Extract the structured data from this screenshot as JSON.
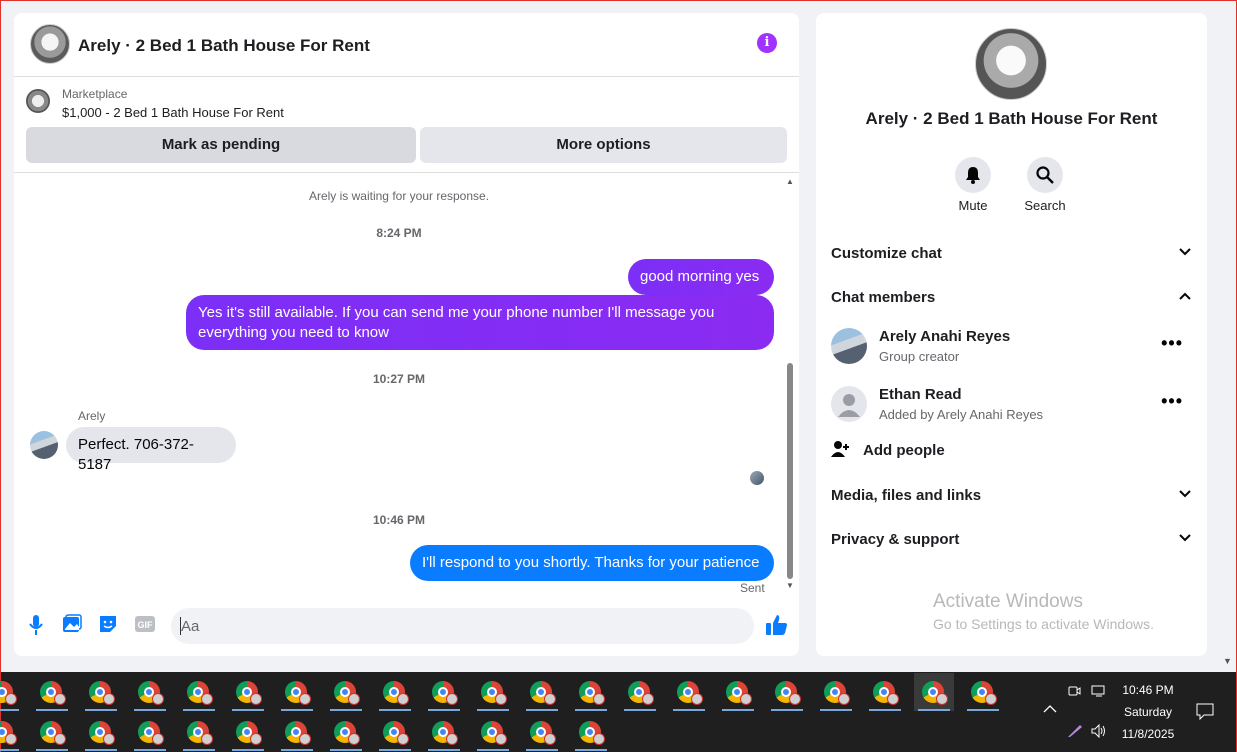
{
  "chat": {
    "header_title": "Arely · 2 Bed 1 Bath House For Rent",
    "marketplace_label": "Marketplace",
    "listing": "$1,000 - 2 Bed 1 Bath House For Rent",
    "mark_pending": "Mark as pending",
    "more_options": "More options",
    "waiting": "Arely is waiting for your response.",
    "time1": "8:24 PM",
    "msg1": "good morning yes",
    "msg2": "Yes it's still available. If you can send me your phone number I'll message you everything you need to know",
    "time2": "10:27 PM",
    "sender": "Arely",
    "msg3": "Perfect. 706-372-5187",
    "time3": "10:46 PM",
    "msg4": "I'll respond to you shortly. Thanks for your patience",
    "sent": "Sent",
    "composer_placeholder": "Aa"
  },
  "info": {
    "title": "Arely · 2 Bed 1 Bath House For Rent",
    "mute": "Mute",
    "search": "Search",
    "customize": "Customize chat",
    "members_header": "Chat members",
    "members": [
      {
        "name": "Arely Anahi Reyes",
        "sub": "Group creator"
      },
      {
        "name": "Ethan Read",
        "sub": "Added by Arely Anahi Reyes"
      }
    ],
    "add_people": "Add people",
    "media": "Media, files and links",
    "privacy": "Privacy & support"
  },
  "watermark": {
    "line1": "Activate Windows",
    "line2": "Go to Settings to activate Windows."
  },
  "taskbar": {
    "time": "10:46 PM",
    "day": "Saturday",
    "date": "11/8/2025"
  },
  "colors": {
    "accent_purple": "#8a2be2",
    "accent_blue": "#0a7cff"
  }
}
